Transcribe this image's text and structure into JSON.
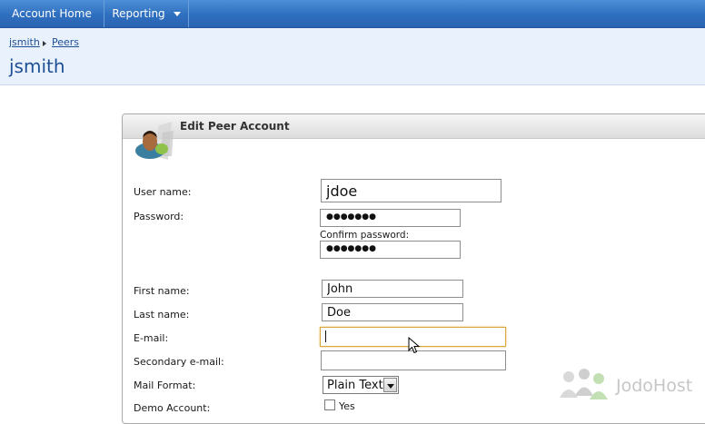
{
  "nav": {
    "home_label": "Account Home",
    "reporting_label": "Reporting"
  },
  "breadcrumb": {
    "root": "jsmith",
    "current": "Peers"
  },
  "page_title": "jsmith",
  "panel": {
    "title": "Edit Peer Account",
    "avatar_icon": "user-avatar-icon"
  },
  "form": {
    "username_label": "User name:",
    "username_value": "jdoe",
    "password_label": "Password:",
    "password_mask": "●●●●●●●",
    "confirm_label": "Confirm password:",
    "confirm_mask": "●●●●●●●",
    "firstname_label": "First name:",
    "firstname_value": "John",
    "lastname_label": "Last name:",
    "lastname_value": "Doe",
    "email_label": "E-mail:",
    "email_value": "",
    "secondary_email_label": "Secondary e-mail:",
    "secondary_email_value": "",
    "mail_format_label": "Mail Format:",
    "mail_format_value": "Plain Text",
    "demo_label": "Demo Account:",
    "demo_checkbox_label": "Yes"
  },
  "watermark": {
    "text": "JodoHost"
  },
  "colors": {
    "nav_blue": "#2f6fc0",
    "header_bg": "#e8f1fc",
    "title_blue": "#1f4f95",
    "focus_border": "#d8a63a"
  }
}
